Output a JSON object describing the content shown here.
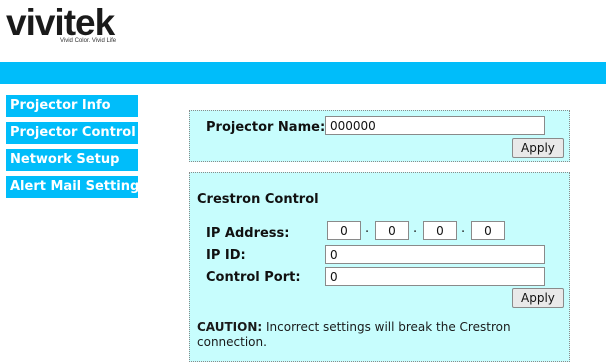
{
  "brand": {
    "logo_text": "vivitek",
    "tagline": "Vivid Color. Vivid Life",
    "accent_color": "#00bdfa",
    "panel_color": "#c7fdfd"
  },
  "sidebar": {
    "items": [
      {
        "label": "Projector Info"
      },
      {
        "label": "Projector Control"
      },
      {
        "label": "Network Setup"
      },
      {
        "label": "Alert Mail Settings"
      }
    ]
  },
  "projector_name": {
    "label": "Projector Name:",
    "value": "000000",
    "apply_label": "Apply"
  },
  "crestron": {
    "title": "Crestron Control",
    "ip_label": "IP Address:",
    "ip_octets": [
      "0",
      "0",
      "0",
      "0"
    ],
    "ip_separator": ".",
    "ip_id_label": "IP ID:",
    "ip_id_value": "0",
    "port_label": "Control Port:",
    "port_value": "0",
    "apply_label": "Apply",
    "caution_prefix": "CAUTION:",
    "caution_text": " Incorrect settings will break the Crestron connection."
  }
}
